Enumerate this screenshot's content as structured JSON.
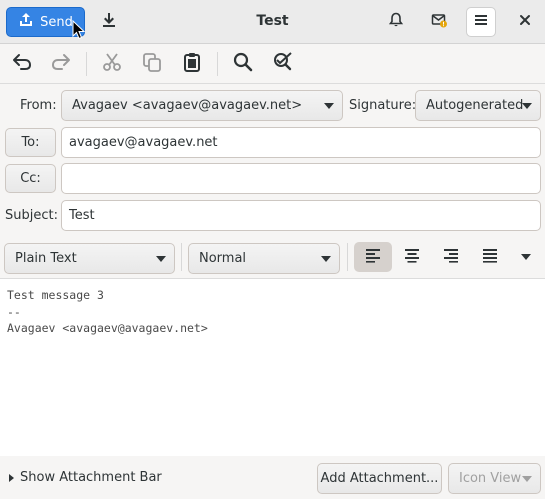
{
  "window": {
    "title": "Test"
  },
  "headerbar": {
    "send_label": "Send",
    "icons": [
      "send-icon",
      "save-draft-icon",
      "notification-bell-icon",
      "mail-alert-icon",
      "hamburger-menu-icon",
      "close-icon"
    ]
  },
  "toolbar": {
    "icons": [
      "undo-icon",
      "redo-icon",
      "cut-icon",
      "copy-icon",
      "paste-icon",
      "find-icon",
      "spell-check-icon"
    ]
  },
  "headers": {
    "from_label": "From:",
    "from_value": "Avagaev <avagaev@avagaev.net>",
    "signature_label": "Signature:",
    "signature_value": "Autogenerated",
    "to_button": "To:",
    "to_value": "avagaev@avagaev.net",
    "cc_button": "Cc:",
    "cc_value": "",
    "subject_label": "Subject:",
    "subject_value": "Test"
  },
  "format": {
    "mode": "Plain Text",
    "paragraph_style": "Normal",
    "alignment_selected": "left"
  },
  "body": {
    "text": "Test message 3\n--\nAvagaev <avagaev@avagaev.net>"
  },
  "bottom": {
    "attachment_bar_label": "Show Attachment Bar",
    "add_attachment_label": "Add Attachment...",
    "view_mode_label": "Icon View"
  },
  "colors": {
    "accent": "#3584e4",
    "headerbar_bg": "#ebebeb",
    "window_bg": "#f6f5f4"
  }
}
